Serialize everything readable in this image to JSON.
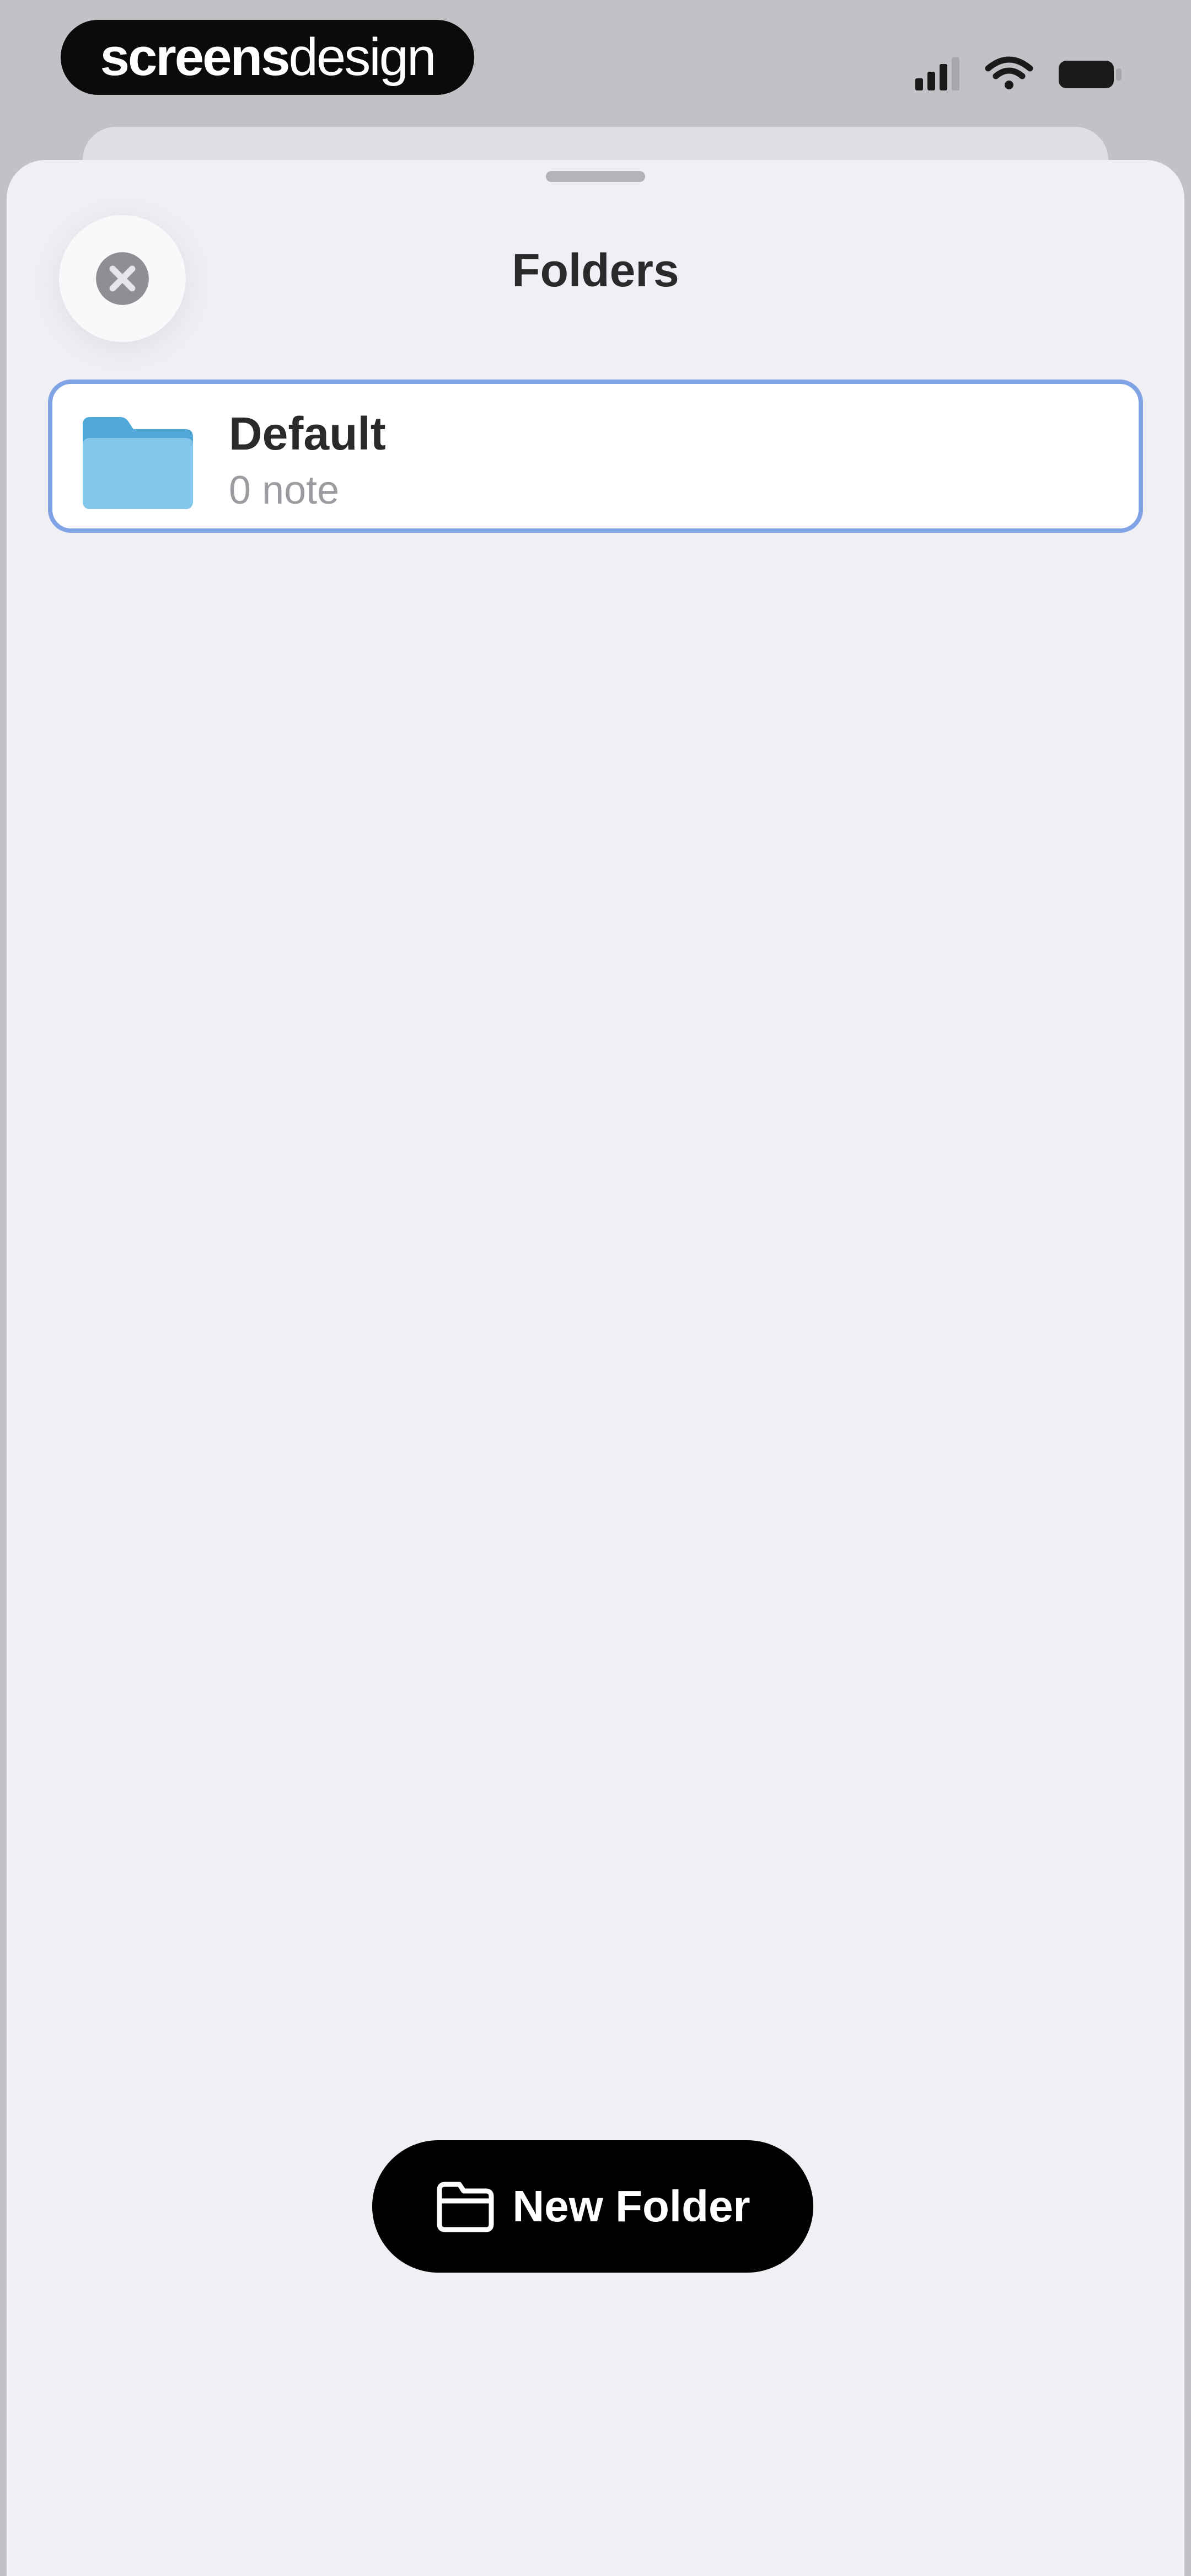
{
  "status_bar": {
    "brand_bold": "screens",
    "brand_light": "design",
    "icons": [
      "cellular-signal-icon",
      "wifi-icon",
      "battery-icon"
    ]
  },
  "sheet": {
    "title": "Folders",
    "close_icon": "close-circle-icon"
  },
  "folders": [
    {
      "name": "Default",
      "count": "0 note",
      "icon": "folder-icon",
      "color": "#5ab8e6",
      "selected": true
    }
  ],
  "footer": {
    "new_folder_label": "New Folder",
    "new_folder_icon": "folder-add-icon"
  },
  "colors": {
    "selection_border": "#7fa3e4",
    "folder": "#5ab8e6",
    "button_bg": "#000000",
    "sheet_bg": "#efeff4"
  }
}
